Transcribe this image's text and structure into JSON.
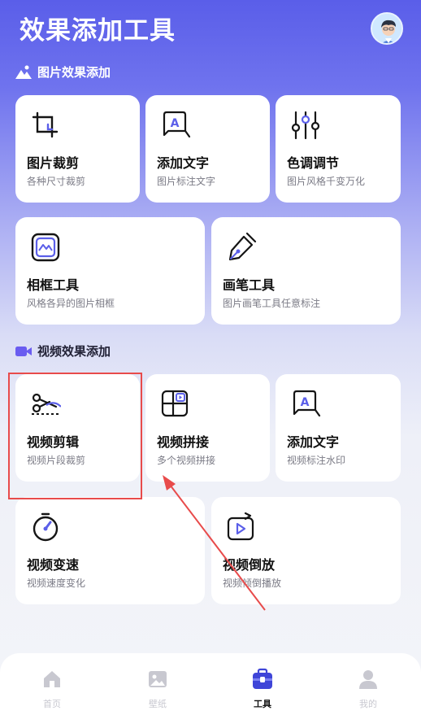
{
  "header": {
    "title": "效果添加工具"
  },
  "sections": [
    {
      "title": "图片效果添加"
    },
    {
      "title": "视频效果添加"
    }
  ],
  "image_tools": [
    {
      "title": "图片裁剪",
      "subtitle": "各种尺寸裁剪",
      "icon": "crop-icon"
    },
    {
      "title": "添加文字",
      "subtitle": "图片标注文字",
      "icon": "text-bubble-icon"
    },
    {
      "title": "色调调节",
      "subtitle": "图片风格千变万化",
      "icon": "sliders-icon"
    },
    {
      "title": "相框工具",
      "subtitle": "风格各异的图片相框",
      "icon": "frame-icon"
    },
    {
      "title": "画笔工具",
      "subtitle": "图片画笔工具任意标注",
      "icon": "pen-icon"
    }
  ],
  "video_tools": [
    {
      "title": "视频剪辑",
      "subtitle": "视频片段裁剪",
      "icon": "scissors-icon"
    },
    {
      "title": "视频拼接",
      "subtitle": "多个视频拼接",
      "icon": "collage-icon"
    },
    {
      "title": "添加文字",
      "subtitle": "视频标注水印",
      "icon": "text-bubble-icon"
    },
    {
      "title": "视频变速",
      "subtitle": "视频速度变化",
      "icon": "speedometer-icon"
    },
    {
      "title": "视频倒放",
      "subtitle": "视频倾倒播放",
      "icon": "reverse-play-icon"
    }
  ],
  "tabbar": {
    "items": [
      {
        "label": "首页",
        "icon": "home-icon"
      },
      {
        "label": "壁纸",
        "icon": "image-icon"
      },
      {
        "label": "工具",
        "icon": "toolbox-icon",
        "active": true
      },
      {
        "label": "我的",
        "icon": "user-icon"
      }
    ]
  },
  "colors": {
    "accent": "#5b5fe9",
    "annotation": "#e84b4b"
  }
}
